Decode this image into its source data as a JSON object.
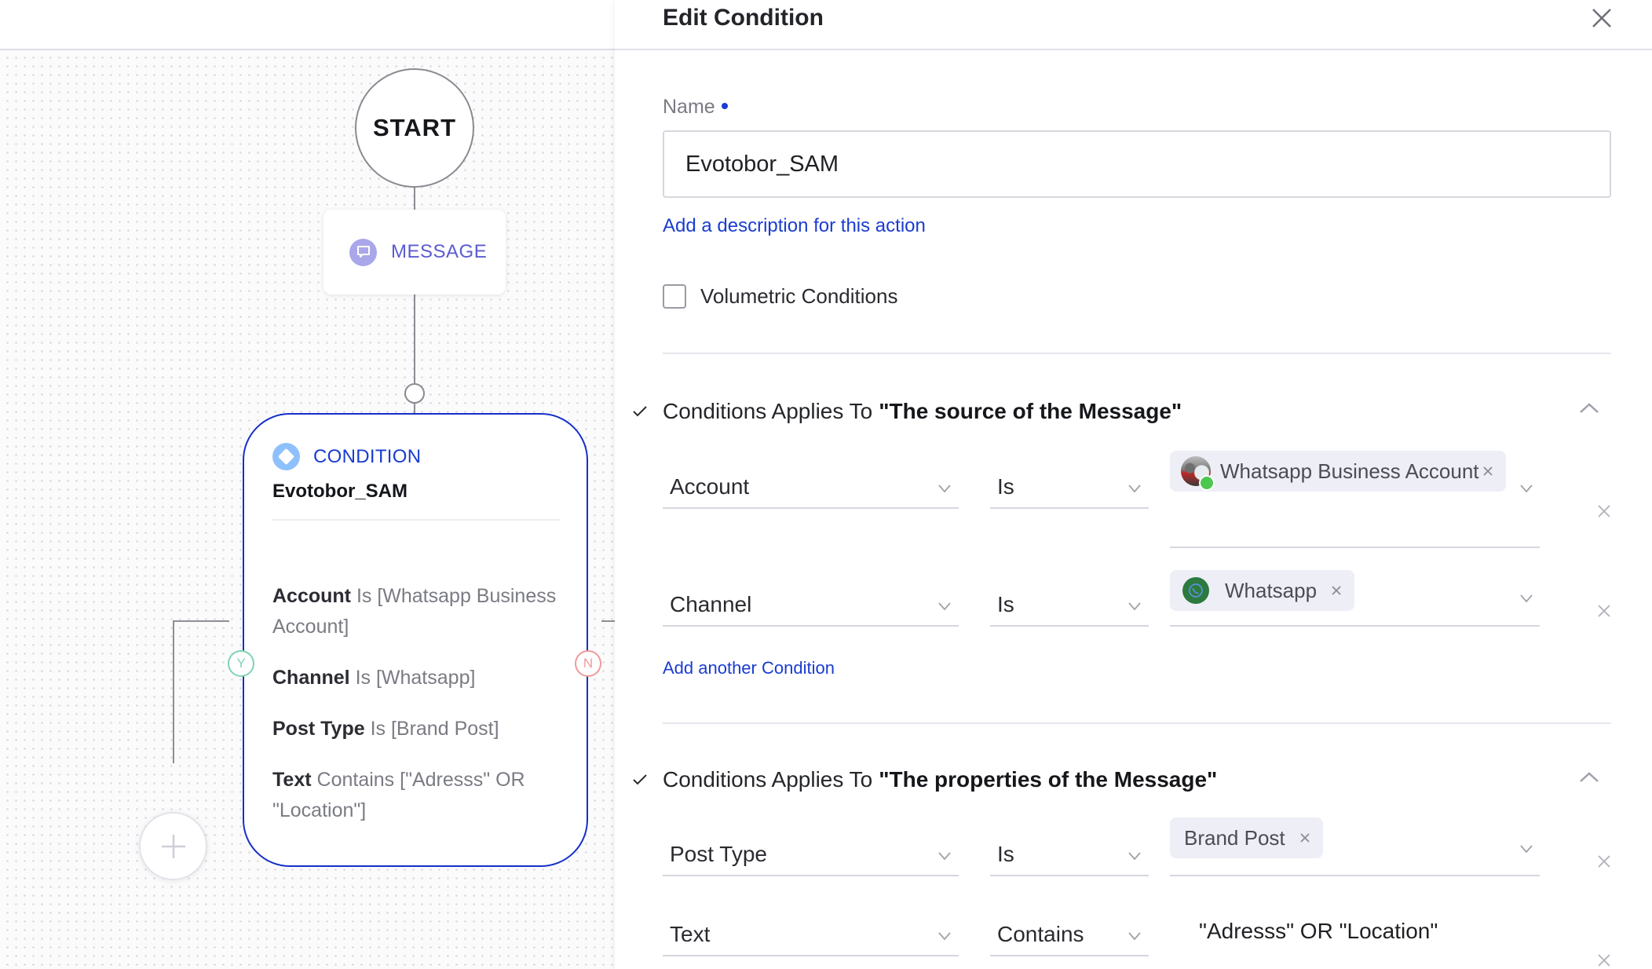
{
  "canvas": {
    "start_label": "START",
    "message_node": {
      "label": "MESSAGE",
      "icon": "chat-bubble-icon"
    },
    "condition_node": {
      "type_label": "CONDITION",
      "icon": "diamond-icon",
      "name": "Evotobor_SAM",
      "rules": [
        {
          "field": "Account",
          "text": " Is [Whatsapp Business Account]"
        },
        {
          "field": "Channel",
          "text": " Is [Whatsapp]"
        },
        {
          "field": "Post Type",
          "text": " Is [Brand Post]"
        },
        {
          "field": "Text",
          "text": " Contains [\"Adresss\" OR \"Location\"]"
        }
      ],
      "yes_badge": "Y",
      "no_badge": "N"
    },
    "add_node_icon": "plus-icon"
  },
  "panel": {
    "title": "Edit Condition",
    "close_icon": "close-icon",
    "name_label": "Name",
    "name_value": "Evotobor_SAM",
    "description_link": "Add a description for this action",
    "volumetric_label": "Volumetric Conditions",
    "volumetric_checked": false,
    "sections": [
      {
        "prefix": "Conditions Applies To",
        "target": "\"The source of the Message\"",
        "expanded": true,
        "rows": [
          {
            "field": "Account",
            "operator": "Is",
            "chips": [
              {
                "label": "Whatsapp Business Account",
                "icon": "account-avatar"
              }
            ]
          },
          {
            "field": "Channel",
            "operator": "Is",
            "chips": [
              {
                "label": "Whatsapp",
                "icon": "whatsapp-icon"
              }
            ]
          }
        ],
        "add_link": "Add another Condition"
      },
      {
        "prefix": "Conditions Applies To",
        "target": "\"The properties of the Message\"",
        "expanded": true,
        "rows": [
          {
            "field": "Post Type",
            "operator": "Is",
            "chips": [
              {
                "label": "Brand Post"
              }
            ]
          },
          {
            "field": "Text",
            "operator": "Contains",
            "text_value": "\"Adresss\" OR \"Location\""
          }
        ]
      }
    ]
  },
  "colors": {
    "accent_blue": "#1a3cd0",
    "condition_border": "#1530c9",
    "message_purple": "#5a5bd1",
    "yes_green": "#7fd3b3",
    "no_red": "#f09a9a",
    "chip_bg": "#eeeef6"
  }
}
